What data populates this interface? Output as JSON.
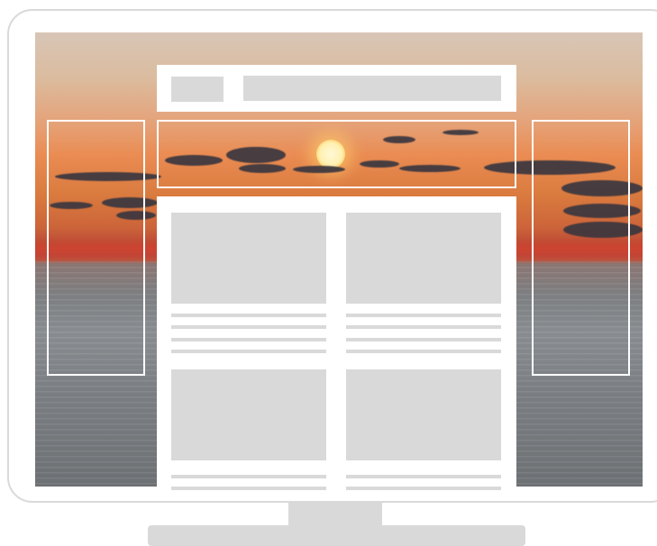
{
  "colors": {
    "frame": "#d9d9d9",
    "placeholder": "#d9d9d9",
    "overlay": "#ffffff"
  },
  "icons": {
    "hero_sun": "sun-icon"
  }
}
